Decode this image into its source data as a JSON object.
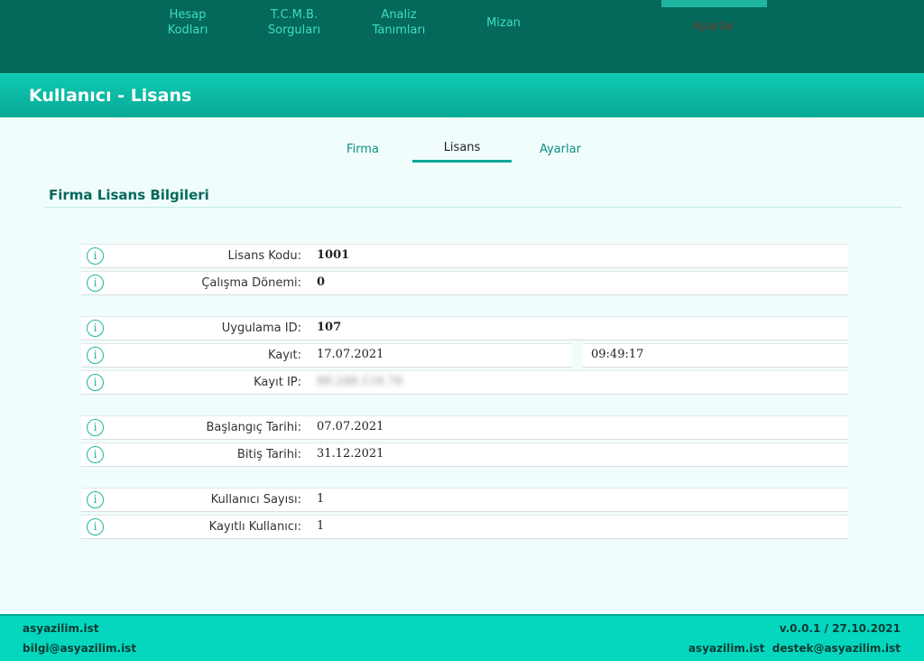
{
  "nav": {
    "items": [
      {
        "label": "Hesap\nKodları"
      },
      {
        "label": "T.C.M.B.\nSorguları"
      },
      {
        "label": "Analiz\nTanımları"
      },
      {
        "label": "Mizan"
      },
      {
        "label": "Ayarlar"
      }
    ]
  },
  "page": {
    "title": "Kullanıcı - Lisans"
  },
  "tabs": [
    {
      "label": "Firma"
    },
    {
      "label": "Lisans"
    },
    {
      "label": "Ayarlar"
    }
  ],
  "section": {
    "title": "Firma Lisans Bilgileri"
  },
  "rows": [
    {
      "label": "Lisans Kodu:",
      "value": "1001"
    },
    {
      "label": "Çalışma Dönemi:",
      "value": "0"
    },
    {
      "label": "Uygulama ID:",
      "value": "107"
    },
    {
      "label": "Kayıt:",
      "value": "17.07.2021",
      "value2": "09:49:17"
    },
    {
      "label": "Kayıt IP:",
      "value": "88.248.118.76"
    },
    {
      "label": "Başlangıç Tarihi:",
      "value": "07.07.2021"
    },
    {
      "label": "Bitiş Tarihi:",
      "value": "31.12.2021"
    },
    {
      "label": "Kullanıcı Sayısı:",
      "value": "1"
    },
    {
      "label": "Kayıtlı Kullanıcı:",
      "value": "1"
    }
  ],
  "info_icon_glyph": "i",
  "footer": {
    "left_top": "asyazilim.ist",
    "left_bottom": "bilgi@asyazilim.ist",
    "right_top": "v.0.0.1 / 27.10.2021",
    "right_bottom": "asyazilim.ist  destek@asyazilim.ist"
  },
  "colors": {
    "nav_bg": "#04695b",
    "accent": "#0fcbb4",
    "footer_bg": "#05d7bf",
    "page_bg": "#f0fdfc"
  }
}
